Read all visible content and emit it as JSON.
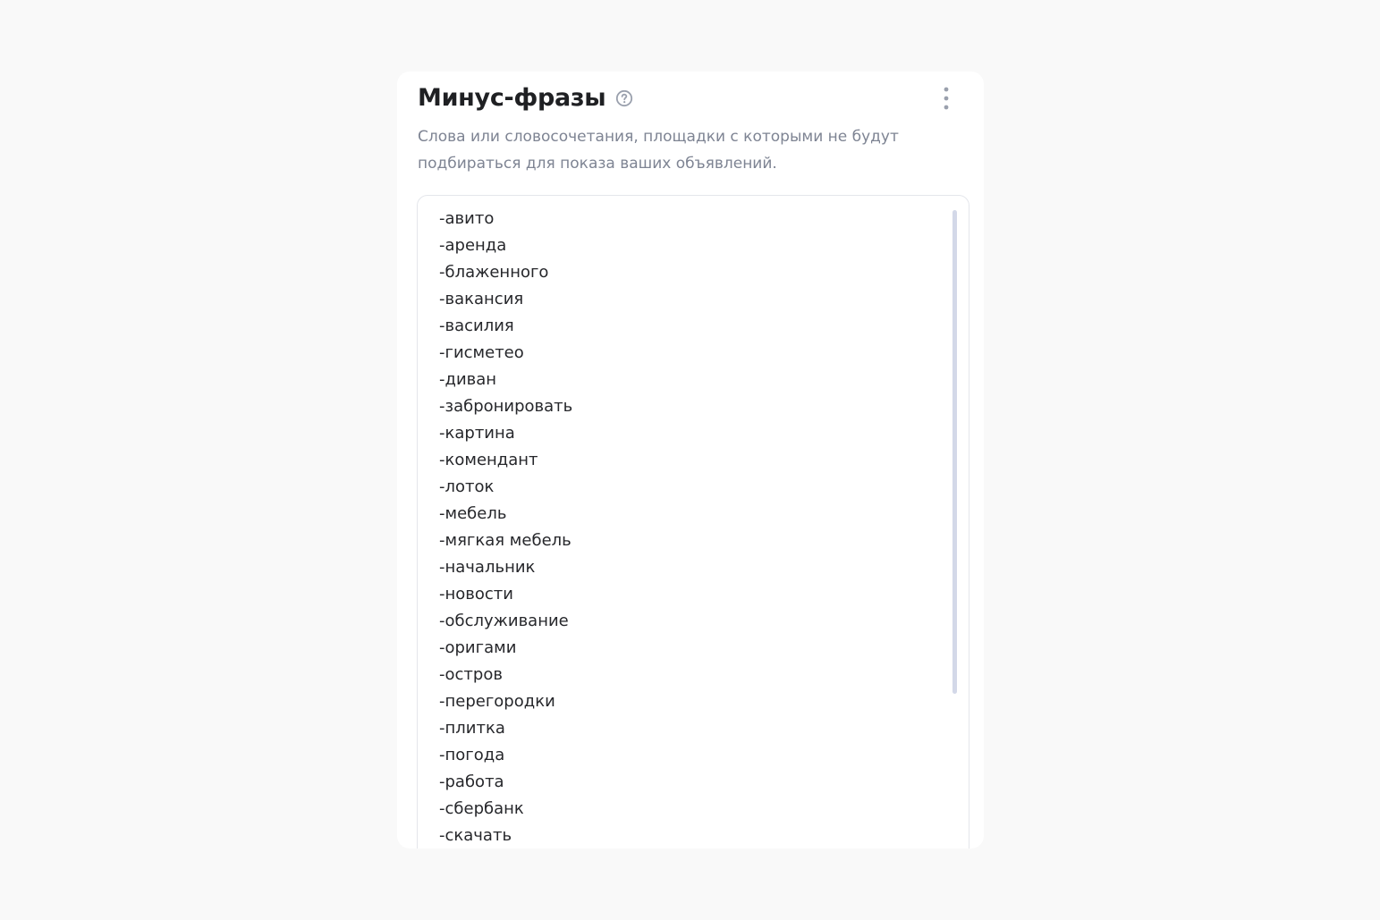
{
  "card": {
    "title": "Минус-фразы",
    "description": "Слова или словосочетания, площадки с которыми не будут подбираться для показа ваших объявлений.",
    "help_icon": "question-circle-icon",
    "menu_icon": "more-vertical-icon"
  },
  "phrases": [
    "-авито",
    "-аренда",
    "-блаженного",
    "-вакансия",
    "-василия",
    "-гисметео",
    "-диван",
    "-забронировать",
    "-картина",
    "-комендант",
    "-лоток",
    "-мебель",
    "-мягкая мебель",
    "-начальник",
    "-новости",
    "-обслуживание",
    "-оригами",
    "-остров",
    "-перегородки",
    "-плитка",
    "-погода",
    "-работа",
    "-сбербанк",
    "-скачать"
  ],
  "colors": {
    "page_background": "#f9f9f9",
    "card_background": "#ffffff",
    "title": "#1f2023",
    "description": "#7e8493",
    "phrase_text": "#26272b",
    "scrollbar": "#d3d8e8",
    "icon": "#9aa0ad"
  }
}
